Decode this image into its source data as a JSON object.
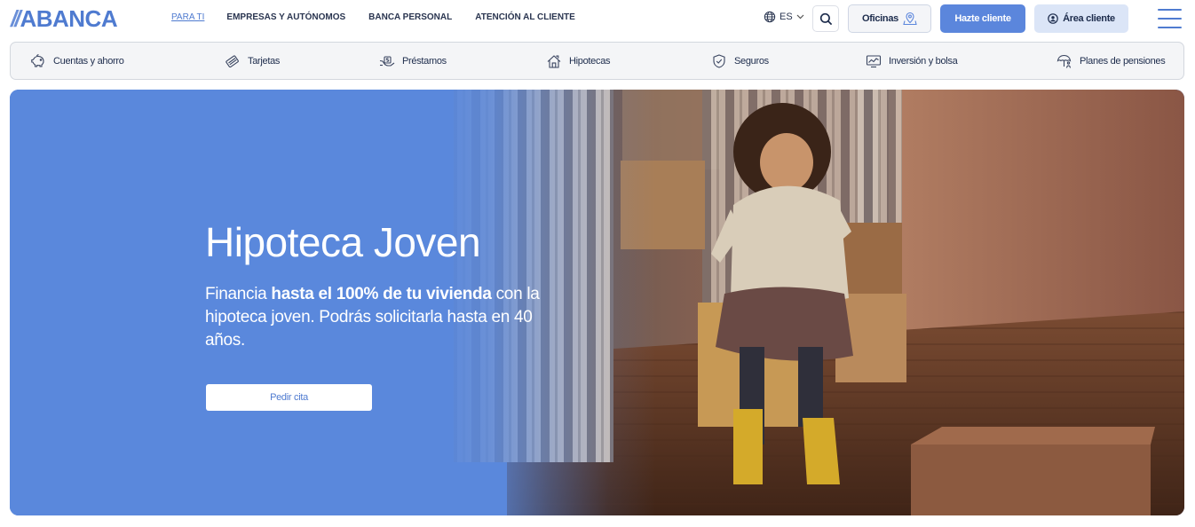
{
  "brand": {
    "logo_slashes": "//",
    "logo_text": "ABANCA"
  },
  "nav": {
    "items": [
      {
        "label": "PARA TI",
        "active": true
      },
      {
        "label": "EMPRESAS Y AUTÓNOMOS",
        "active": false
      },
      {
        "label": "BANCA PERSONAL",
        "active": false
      },
      {
        "label": "ATENCIÓN AL CLIENTE",
        "active": false
      }
    ]
  },
  "header": {
    "language": "ES",
    "search_icon": "search-icon",
    "oficinas_label": "Oficinas",
    "hazte_cliente_label": "Hazte cliente",
    "area_cliente_label": "Área cliente",
    "menu_icon": "hamburger-menu-icon"
  },
  "products": [
    {
      "label": "Cuentas y ahorro",
      "icon": "piggy-bank-icon"
    },
    {
      "label": "Tarjetas",
      "icon": "card-icon"
    },
    {
      "label": "Préstamos",
      "icon": "handshake-money-icon"
    },
    {
      "label": "Hipotecas",
      "icon": "house-icon"
    },
    {
      "label": "Seguros",
      "icon": "shield-check-icon"
    },
    {
      "label": "Inversión y bolsa",
      "icon": "chart-screen-icon"
    },
    {
      "label": "Planes de pensiones",
      "icon": "umbrella-person-icon"
    }
  ],
  "hero": {
    "title": "Hipoteca Joven",
    "text_pre": "Financia ",
    "text_bold": "hasta el 100% de tu vivienda",
    "text_post": " con la hipoteca joven. Podrás solicitarla hasta en 40 años.",
    "cta_label": "Pedir cita"
  },
  "colors": {
    "brand_blue": "#4f7bd0",
    "hero_blue": "#5a88dc",
    "primary_button": "#5b86dc",
    "secondary_button": "#dbe5f7"
  }
}
